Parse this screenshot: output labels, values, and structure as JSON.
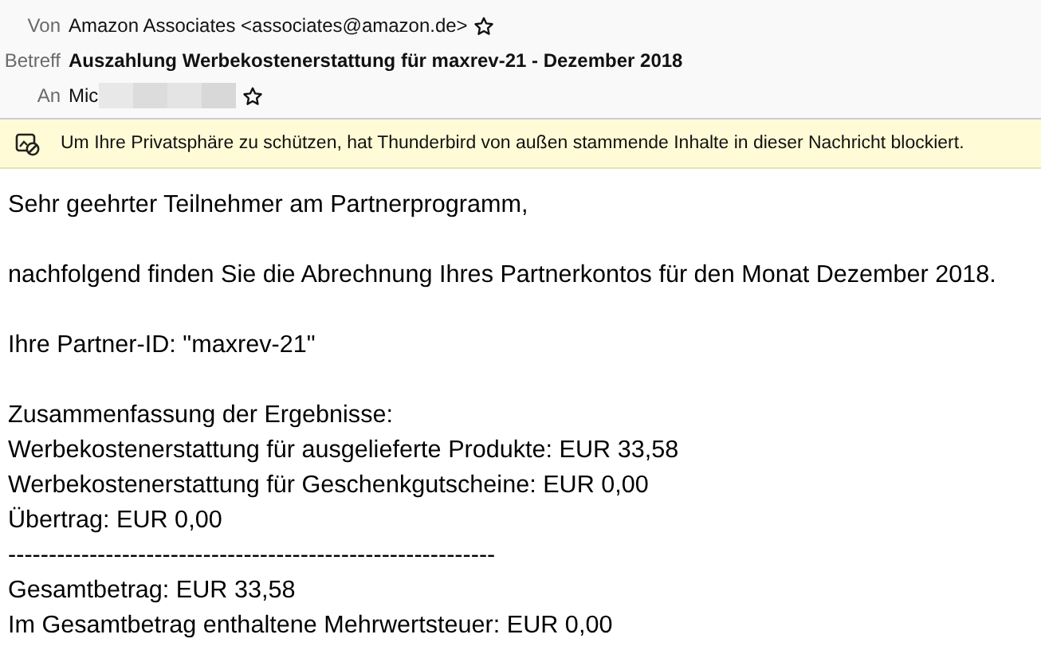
{
  "header": {
    "fields": [
      {
        "label": "Von",
        "value": "Amazon Associates <associates@amazon.de>",
        "bold": false,
        "starred": false,
        "redacted": false
      },
      {
        "label": "Betreff",
        "value": "Auszahlung Werbekostenerstattung für maxrev-21 - Dezember 2018",
        "bold": true,
        "redacted": false
      },
      {
        "label": "An",
        "value": "Mic",
        "bold": false,
        "starred": false,
        "redacted": true
      }
    ]
  },
  "notification": {
    "text": "Um Ihre Privatsphäre zu schützen, hat Thunderbird von außen stammende Inhalte in dieser Nachricht blockiert."
  },
  "body": {
    "paragraphs": [
      [
        "Sehr geehrter Teilnehmer am Partnerprogramm,"
      ],
      [
        "nachfolgend finden Sie die Abrechnung Ihres Partnerkontos für den Monat Dezember 2018."
      ],
      [
        "Ihre Partner-ID: \"maxrev-21\""
      ],
      [
        "Zusammenfassung der Ergebnisse:",
        "Werbekostenerstattung für ausgelieferte Produkte: EUR 33,58",
        "Werbekostenerstattung für Geschenkgutscheine: EUR 0,00",
        "Übertrag: EUR 0,00",
        "------------------------------------------------------------",
        "Gesamtbetrag: EUR 33,58",
        "Im Gesamtbetrag enthaltene Mehrwertsteuer: EUR 0,00"
      ]
    ]
  }
}
